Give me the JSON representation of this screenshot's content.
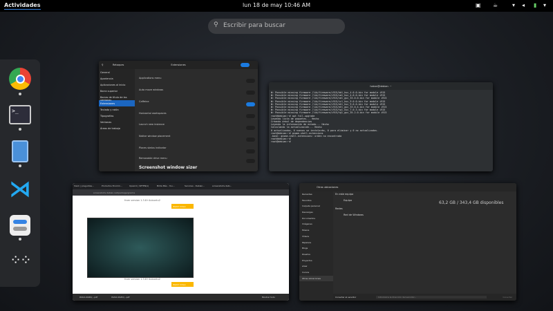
{
  "topbar": {
    "activities": "Actividades",
    "clock": "lun 18 de may  10:46 AM",
    "icons": [
      "system-monitor-icon",
      "coffee-icon",
      "wifi-icon",
      "volume-icon",
      "battery-icon",
      "chevron-down-icon"
    ]
  },
  "search": {
    "placeholder": "Escribir para buscar"
  },
  "dash": {
    "apps": [
      "chrome",
      "terminal",
      "text-editor",
      "vscode",
      "tweaks",
      "show-apps"
    ]
  },
  "tweaks": {
    "title": "Retoques",
    "header": "Extensiones",
    "sidebar": [
      "General",
      "Apariencia",
      "Aplicaciones al inicio",
      "Barra superior",
      "Barras de título de las ventanas",
      "Extensiones",
      "Teclado y ratón",
      "Tipografías",
      "Ventanas",
      "Áreas de trabajo"
    ],
    "selected": 5,
    "rows": [
      {
        "name": "Applications menu",
        "on": false
      },
      {
        "name": "Auto move windows",
        "on": false
      },
      {
        "name": "Caffeine",
        "on": true
      },
      {
        "name": "Horizontal workspaces",
        "on": false
      },
      {
        "name": "Launch new instance",
        "on": false
      },
      {
        "name": "Native window placement",
        "on": false
      },
      {
        "name": "Places status indicator",
        "on": false
      },
      {
        "name": "Removable drive menu",
        "on": false
      },
      {
        "name": "Screenshot window sizer",
        "on": false
      }
    ]
  },
  "terminal": {
    "title": "hakan@debian: ~",
    "lines": "W: Possible missing firmware /lib/firmware/i915/kbl_huc_4.0.0.bin for module i915\nW: Possible missing firmware /lib/firmware/i915/cml_huc_4.0.0.bin for module i915\nW: Possible missing firmware /lib/firmware/i915/cml_guc_33.0.0.bin for module i915\nW: Possible missing firmware /lib/firmware/i915/icl_huc_9.0.0.bin for module i915\nW: Possible missing firmware /lib/firmware/i915/ehl_huc_9.0.0.bin for module i915\nW: Possible missing firmware /lib/firmware/i915/ehl_guc_33.0.4.bin for module i915\nW: Possible missing firmware /lib/firmware/i915/tgl_huc_7.0.3.bin for module i915\nW: Possible missing firmware /lib/firmware/i915/tgl_guc_35.2.0.bin for module i915\nroot@debian:~# apt full-upgrade\nLeyendo lista de paquetes... Hecho\nCreando árbol de dependencias\nLeyendo la información de estado... Hecho\nCalculando la actualización... Hecho\n0 actualizados, 0 nuevos se instalarán, 0 para eliminar y 0 no actualizados.\nroot@debian:~# gnome-shell-extensions\n-bash: gnome-shell-extensions: orden no encontrada\nroot@debian:~#\nroot@debian:~# "
  },
  "browser": {
    "tabs": [
      "Slack | preguntas...",
      "Productos Ecomm...",
      "Upwork | SPTEN(1)",
      "Brilla Más - You...",
      "Services - Debian...",
      "screenshots.debi..."
    ],
    "url": "screenshots.debian.net/package/gnome",
    "version1": "from version 1.3.8+4ubuntu2",
    "version2": "from version 1.3.8+4ubuntu2",
    "button": "Watch Video",
    "downloads": [
      "PASO-00#0(...pdf",
      "PASO-00#0(...pdf"
    ],
    "show_all": "Mostrar todo"
  },
  "files": {
    "location": "Otras ubicaciones",
    "sidebar": [
      "Recientes",
      "Favoritos",
      "Carpeta personal",
      "Descargas",
      "Documentos",
      "Imágenes",
      "Música",
      "Vídeos",
      "Papelera",
      "Blogs",
      "Diseños",
      "Proyectos",
      "www",
      "Cursos",
      "Otras ubicaciones"
    ],
    "section_this": "En este equipo",
    "equipo": "Equipo",
    "equipo_size": "63,2 GB / 343,4 GB disponibles",
    "section_net": "Redes",
    "windows_net": "Red de Windows",
    "connect_label": "Conectar al servidor",
    "address_placeholder": "Introduzca la dirección del servidor...",
    "connect_btn": "Conectar"
  }
}
